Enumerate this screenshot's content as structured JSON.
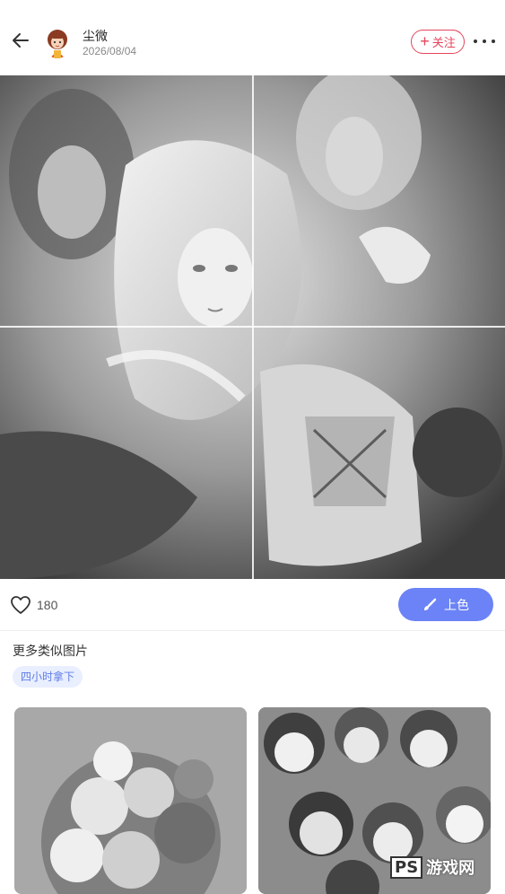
{
  "header": {
    "username": "尘微",
    "date": "2026/08/04",
    "follow_label": "关注",
    "follow_plus": "+"
  },
  "actions": {
    "like_count": "180",
    "color_button_label": "上色"
  },
  "similar": {
    "title": "更多类似图片",
    "tag": "四小时拿下"
  },
  "watermark": {
    "logo": "PS",
    "text": "游戏网"
  },
  "colors": {
    "follow_accent": "#e6455b",
    "primary_button": "#6b83f6",
    "tag_bg": "#e9efff",
    "tag_text": "#5f7ce8"
  },
  "icons": {
    "back": "arrow-left-icon",
    "more": "more-horizontal-icon",
    "like": "heart-outline-icon",
    "brush": "brush-icon"
  }
}
